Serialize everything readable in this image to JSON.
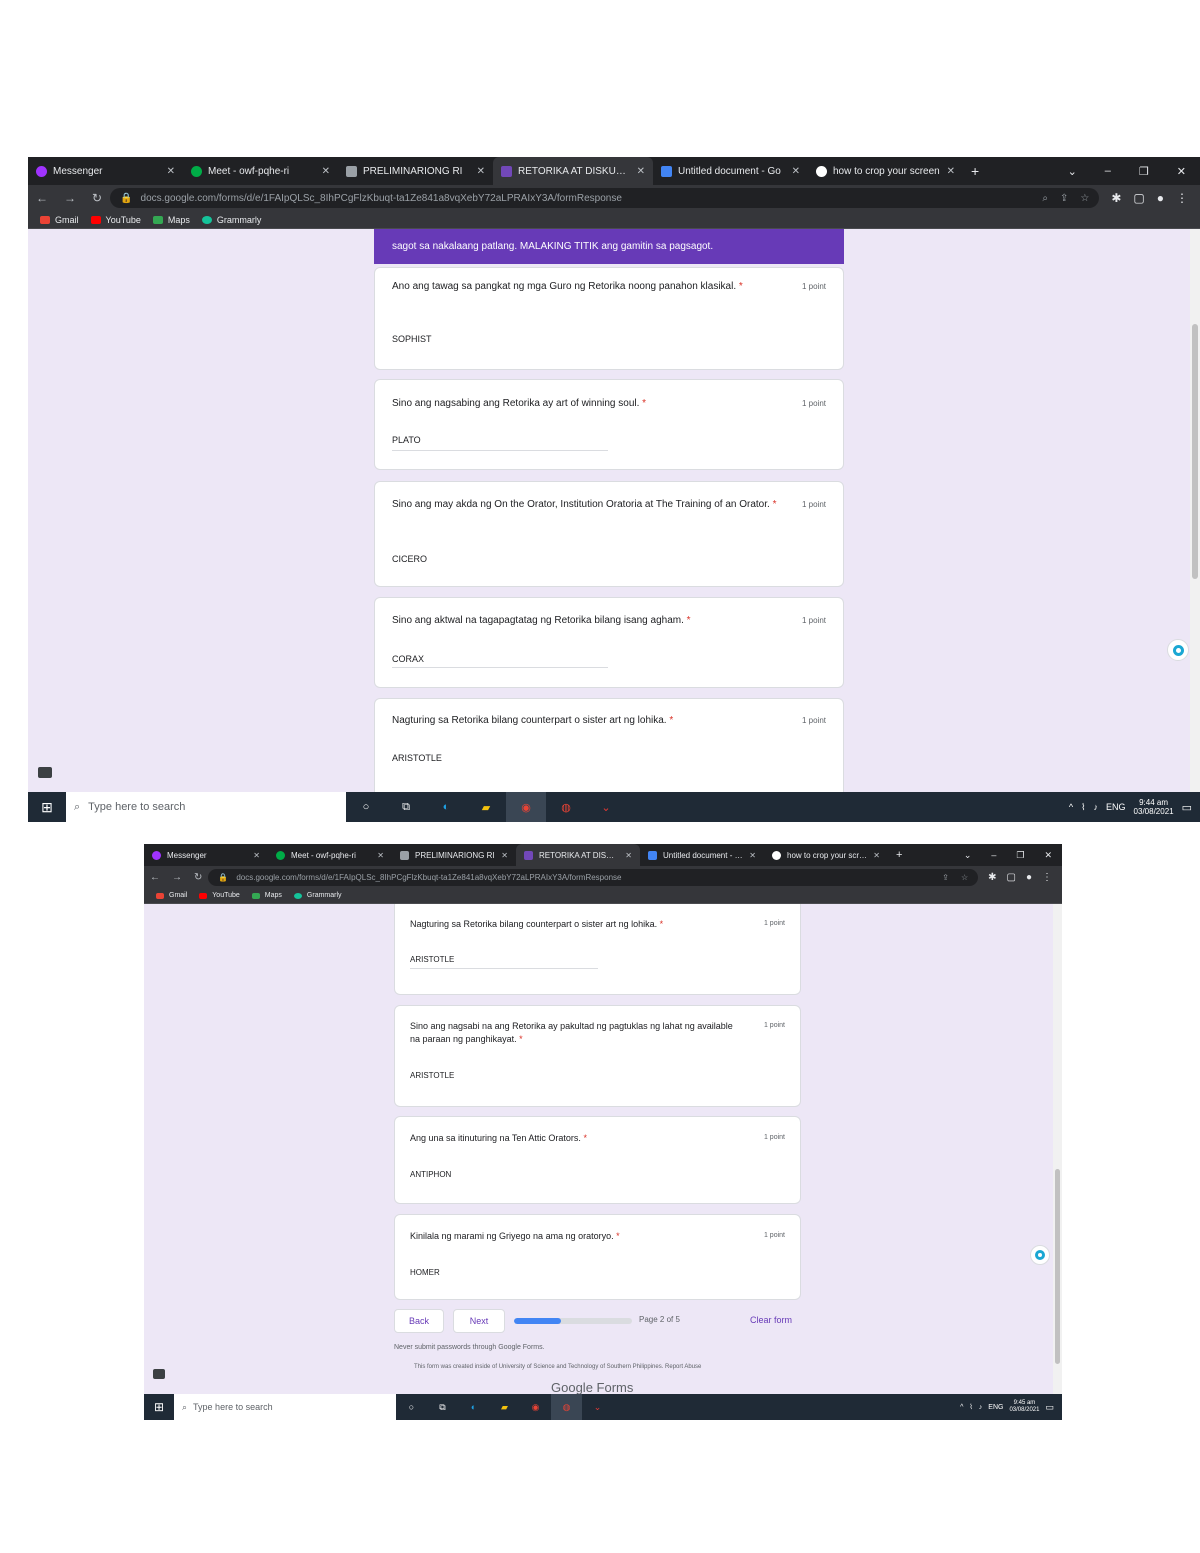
{
  "browser": {
    "tabs": [
      {
        "title": "Messenger",
        "color": "#a033ff"
      },
      {
        "title": "Meet - owf-pqhe-ri",
        "color": "#00ac47"
      },
      {
        "title": "PRELIMINARIONG RI",
        "color": "#9aa0a6"
      },
      {
        "title": "RETORIKA AT DISKURSO",
        "color": "#7248b9"
      },
      {
        "title": "Untitled document - Go",
        "color": "#4285f4"
      },
      {
        "title": "how to crop your screen",
        "color": "#ffffff"
      }
    ],
    "url": "docs.google.com/forms/d/e/1FAIpQLSc_8IhPCgFlzKbuqt-ta1Ze841a8vqXebY72aLPRAIxY3A/formResponse",
    "url_host": "docs.google.com",
    "bookmarks": [
      {
        "label": "Gmail",
        "color": "#ea4335"
      },
      {
        "label": "YouTube",
        "color": "#ff0000"
      },
      {
        "label": "Maps",
        "color": "#34a853"
      },
      {
        "label": "Grammarly",
        "color": "#15c39a"
      }
    ]
  },
  "screen1": {
    "header_text": "sagot sa nakalaang patlang. MALAKING TITIK ang gamitin sa pagsagot.",
    "questions": [
      {
        "text": "Ano ang tawag sa pangkat ng mga Guro ng Retorika noong panahon klasikal.",
        "points": "1 point",
        "answer": "SOPHIST"
      },
      {
        "text": "Sino ang nagsabing ang Retorika ay art of winning soul.",
        "points": "1 point",
        "answer": "PLATO"
      },
      {
        "text": "Sino ang may akda ng On the Orator, Institution Oratoria at The Training of an Orator.",
        "points": "1 point",
        "answer": "CICERO"
      },
      {
        "text": "Sino ang aktwal na tagapagtatag ng Retorika bilang isang agham.",
        "points": "1 point",
        "answer": "CORAX"
      },
      {
        "text": "Nagturing sa Retorika bilang counterpart o sister art ng lohika.",
        "points": "1 point",
        "answer": "ARISTOTLE"
      }
    ],
    "taskbar": {
      "search": "Type here to search",
      "lang": "ENG",
      "time": "9:44 am",
      "date": "03/08/2021"
    }
  },
  "screen2": {
    "questions": [
      {
        "text": "Nagturing sa Retorika bilang counterpart o sister art ng lohika.",
        "points": "1 point",
        "answer": "ARISTOTLE"
      },
      {
        "text": "Sino ang nagsabi na ang Retorika ay pakultad ng pagtuklas ng lahat ng available na paraan ng panghikayat.",
        "points": "1 point",
        "answer": "ARISTOTLE"
      },
      {
        "text": "Ang una sa itinuturing na Ten Attic Orators.",
        "points": "1 point",
        "answer": "ANTIPHON"
      },
      {
        "text": "Kinilala ng marami ng Griyego na ama ng oratoryo.",
        "points": "1 point",
        "answer": "HOMER"
      }
    ],
    "back_label": "Back",
    "next_label": "Next",
    "progress": 0.4,
    "page_text": "Page 2 of 5",
    "clear_label": "Clear form",
    "password_notice": "Never submit passwords through Google Forms.",
    "footer_text": "This form was created inside of University of Science and Technology of Southern Philippines. Report Abuse",
    "google_forms": "Google Forms",
    "taskbar": {
      "search": "Type here to search",
      "lang": "ENG",
      "time": "9:45 am",
      "date": "03/08/2021"
    }
  }
}
